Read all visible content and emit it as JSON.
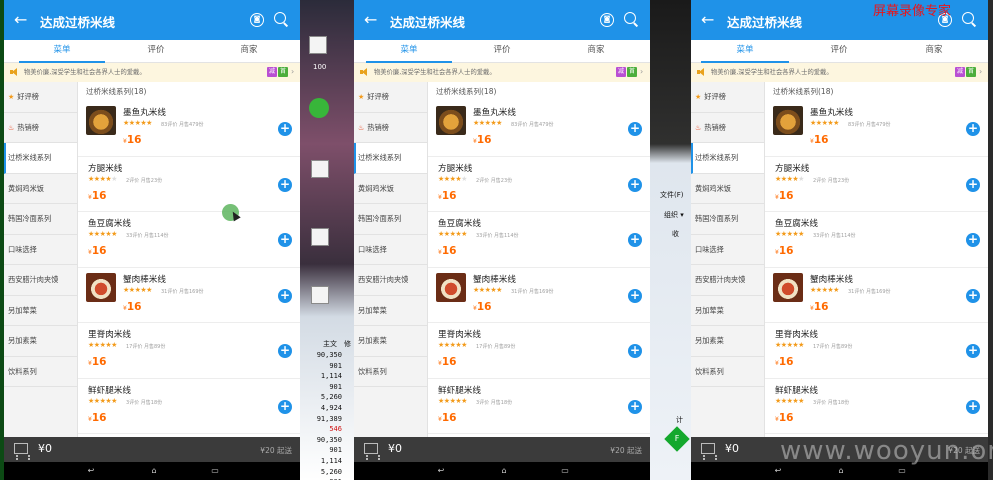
{
  "app": {
    "title": "达成过桥米线",
    "tabs": [
      "菜单",
      "评价",
      "商家"
    ],
    "notice": "物美价廉,深受学生和社会各界人士的爱戴。",
    "promo_tags": [
      {
        "label": "减",
        "color": "#b94fd3"
      },
      {
        "label": "首",
        "color": "#4cae3c"
      }
    ],
    "categories": [
      {
        "label": "好评榜",
        "icon": "star-icon"
      },
      {
        "label": "热销榜",
        "icon": "fire-icon"
      },
      {
        "label": "过桥米线系列"
      },
      {
        "label": "黄焖鸡米饭"
      },
      {
        "label": "韩国冷面系列"
      },
      {
        "label": "口味选择"
      },
      {
        "label": "西安腊汁肉夹馍"
      },
      {
        "label": "另加荤菜"
      },
      {
        "label": "另加素菜"
      },
      {
        "label": "饮料系列"
      }
    ],
    "active_category": "过桥米线系列",
    "section_title": "过桥米线系列(18)",
    "dishes": [
      {
        "name": "墨鱼丸米线",
        "rating": 5,
        "meta": "83评价 月售479份",
        "currency": "¥",
        "price": "16",
        "has_image": true
      },
      {
        "name": "方腿米线",
        "rating": 4,
        "meta": "2评价 月售23份",
        "currency": "¥",
        "price": "16",
        "has_image": false
      },
      {
        "name": "鱼豆腐米线",
        "rating": 5,
        "meta": "33评价 月售114份",
        "currency": "¥",
        "price": "16",
        "has_image": false
      },
      {
        "name": "蟹肉棒米线",
        "rating": 5,
        "meta": "31评价 月售169份",
        "currency": "¥",
        "price": "16",
        "has_image": true
      },
      {
        "name": "里脊肉米线",
        "rating": 5,
        "meta": "17评价 月售89份",
        "currency": "¥",
        "price": "16",
        "has_image": false
      },
      {
        "name": "鲜虾腿米线",
        "rating": 5,
        "meta": "3评价 月售18份",
        "currency": "¥",
        "price": "16",
        "has_image": false
      }
    ],
    "cart_total": "¥0",
    "min_order": "¥20 起送",
    "add_label": "+"
  },
  "desktop": {
    "labels": [
      "100",
      "6",
      "文件(F)",
      "组织 ▾",
      "收",
      "计",
      "主文",
      "修"
    ],
    "numbers": [
      "90,350",
      "901",
      "1,114",
      "901",
      "5,260",
      "4,924",
      "91,389",
      "546",
      "90,350",
      "901",
      "1,114",
      "5,260",
      "901"
    ],
    "numbers_red_index": 7
  },
  "watermarks": {
    "recorder": "屏幕录像专家",
    "site": "www.wooyun.org"
  },
  "colors": {
    "primary": "#1f92e8",
    "price": "#ff6a00",
    "star": "#f39b1b",
    "notice_bg": "#fdf6df",
    "bottom_bar": "#3b3b3b"
  }
}
